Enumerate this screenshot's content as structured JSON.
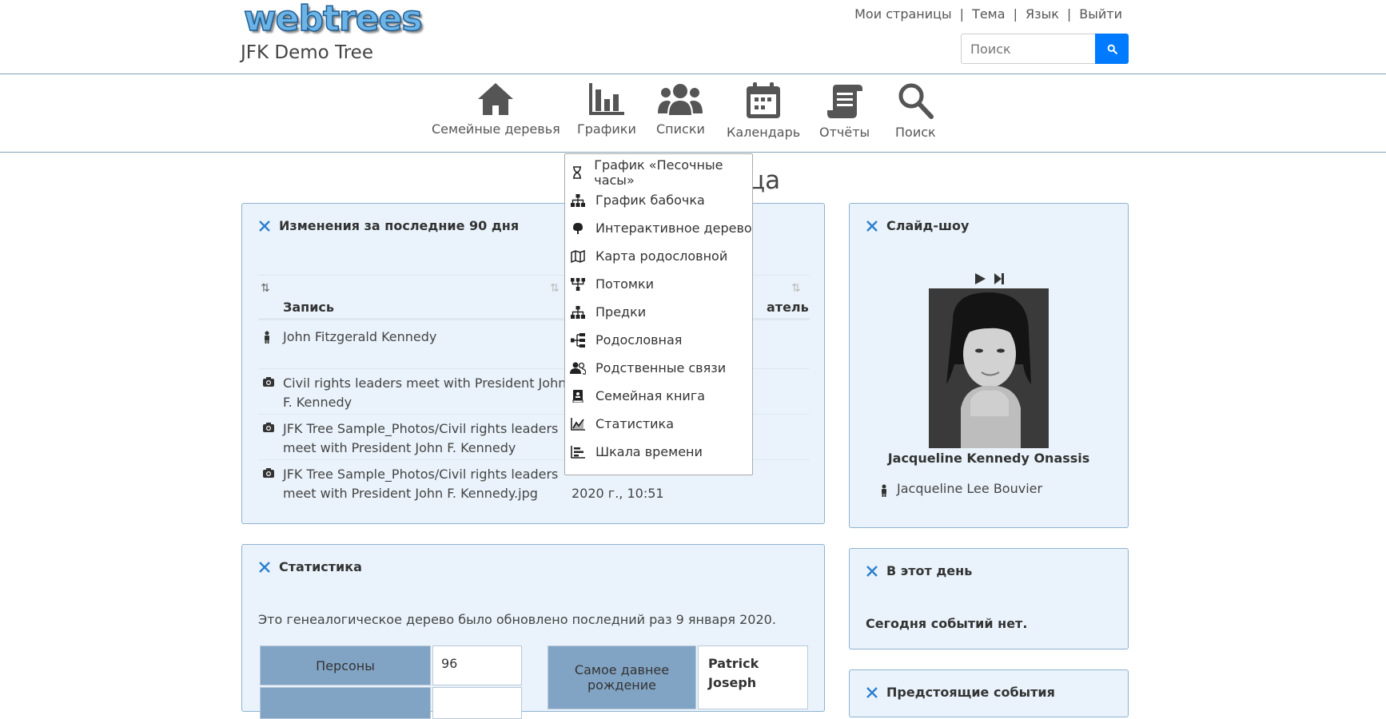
{
  "header": {
    "logo_text": "webtrees",
    "tree_title": "JFK Demo Tree",
    "user_links": [
      "Мои страницы",
      "Тема",
      "Язык",
      "Выйти"
    ],
    "search_placeholder": "Поиск"
  },
  "nav": [
    {
      "label": "Семейные деревья",
      "icon": "home-icon"
    },
    {
      "label": "Графики",
      "icon": "bar-chart-icon"
    },
    {
      "label": "Списки",
      "icon": "users-icon"
    },
    {
      "label": "Календарь",
      "icon": "calendar-icon"
    },
    {
      "label": "Отчёты",
      "icon": "scroll-icon"
    },
    {
      "label": "Поиск",
      "icon": "search-icon"
    }
  ],
  "page_title_fragment": "ца",
  "charts_menu": [
    {
      "label": "График «Песочные часы»",
      "icon": "hourglass-icon"
    },
    {
      "label": "График бабочка",
      "icon": "sitemap-icon"
    },
    {
      "label": "Интерактивное дерево",
      "icon": "tree-icon"
    },
    {
      "label": "Карта родословной",
      "icon": "map-icon"
    },
    {
      "label": "Потомки",
      "icon": "descendants-icon"
    },
    {
      "label": "Предки",
      "icon": "sitemap-icon"
    },
    {
      "label": "Родословная",
      "icon": "pedigree-icon"
    },
    {
      "label": "Родственные связи",
      "icon": "relationship-icon"
    },
    {
      "label": "Семейная книга",
      "icon": "book-icon"
    },
    {
      "label": "Статистика",
      "icon": "statistics-icon"
    },
    {
      "label": "Шкала времени",
      "icon": "timeline-icon"
    }
  ],
  "recent_changes": {
    "title": "Изменения за последние 90 дня",
    "col_record": "Запись",
    "col_user_fragment": "атель",
    "rows": [
      {
        "icon": "person-icon",
        "text": "John Fitzgerald Kennedy",
        "date": ""
      },
      {
        "icon": "camera-icon",
        "text": "Civil rights leaders meet with President John F. Kennedy",
        "date": ""
      },
      {
        "icon": "camera-icon",
        "text": "JFK Tree Sample_Photos/Civil rights leaders meet with President John F. Kennedy",
        "date": ""
      },
      {
        "icon": "camera-icon",
        "text": "JFK Tree Sample_Photos/Civil rights leaders meet with President John F. Kennedy.jpg",
        "date": "2020 г., 10:51"
      }
    ]
  },
  "statistics": {
    "title": "Статистика",
    "updated_text": "Это генеалогическое дерево было обновлено последний раз 9 января 2020.",
    "persons_label": "Персоны",
    "persons_value": "96",
    "earliest_birth_label": "Самое давнее рождение",
    "earliest_birth_value": "Patrick Joseph"
  },
  "slideshow": {
    "title": "Слайд-шоу",
    "caption": "Jacqueline Kennedy Onassis",
    "person_link": "Jacqueline Lee Bouvier"
  },
  "on_this_day": {
    "title": "В этот день",
    "text": "Сегодня событий нет."
  },
  "upcoming": {
    "title": "Предстоящие события"
  },
  "colors": {
    "accent": "#007bff",
    "card_bg": "#eaf3fb",
    "card_border": "#8eb2d0",
    "stat_header": "#82a4c4",
    "tool_icon": "#2a7fcf"
  }
}
